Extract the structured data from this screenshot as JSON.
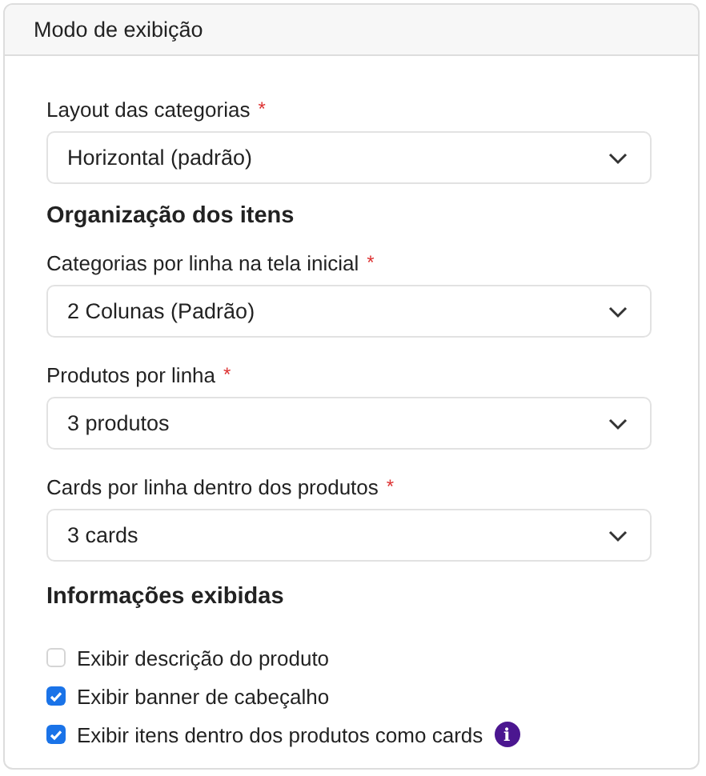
{
  "panel": {
    "title": "Modo de exibição"
  },
  "items": [
    {
      "kind": "select",
      "label": "Layout das categorias",
      "required": true,
      "required_mark": "*",
      "value": "Horizontal (padrão)"
    },
    {
      "kind": "heading",
      "text": "Organização dos itens"
    },
    {
      "kind": "select",
      "label": "Categorias por linha na tela inicial",
      "required": true,
      "required_mark": "*",
      "value": "2 Colunas (Padrão)"
    },
    {
      "kind": "select",
      "label": "Produtos por linha",
      "required": true,
      "required_mark": "*",
      "value": "3 produtos"
    },
    {
      "kind": "select",
      "label": "Cards por linha dentro dos produtos",
      "required": true,
      "required_mark": "*",
      "value": "3 cards"
    },
    {
      "kind": "heading",
      "text": "Informações exibidas"
    },
    {
      "kind": "checkbox",
      "label": "Exibir descrição do produto",
      "checked": false,
      "info": false
    },
    {
      "kind": "checkbox",
      "label": "Exibir banner de cabeçalho",
      "checked": true,
      "info": false
    },
    {
      "kind": "checkbox",
      "label": "Exibir itens dentro dos produtos como cards",
      "checked": true,
      "info": true,
      "info_glyph": "i"
    }
  ]
}
